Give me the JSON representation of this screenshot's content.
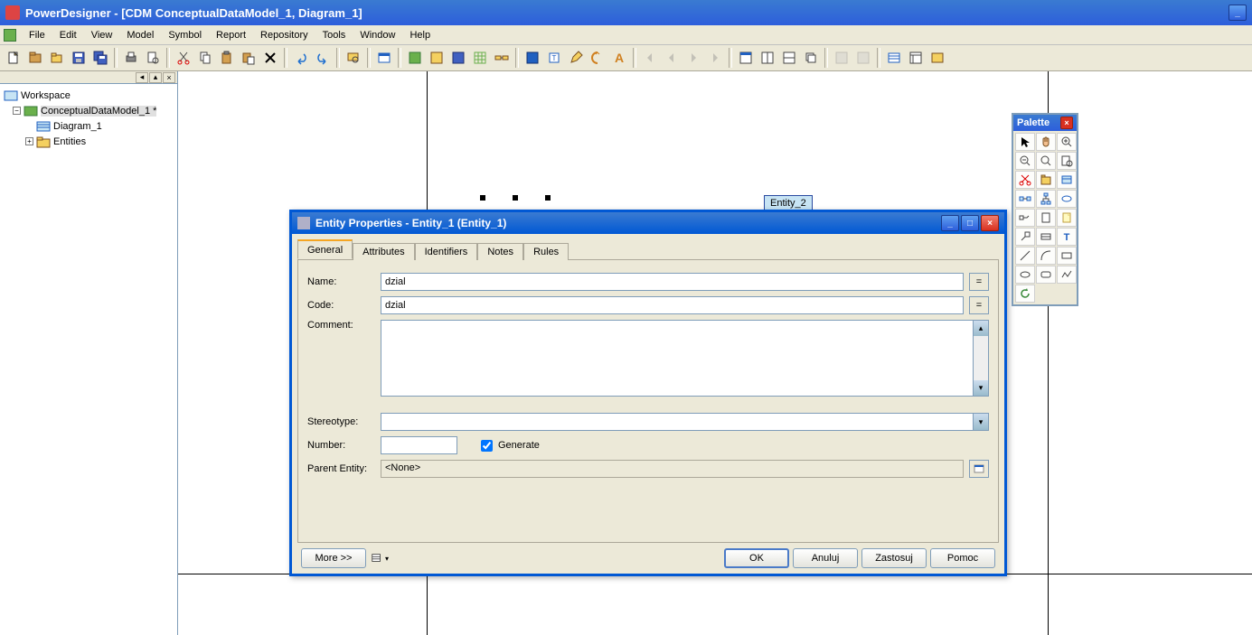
{
  "app": {
    "title": "PowerDesigner - [CDM ConceptualDataModel_1, Diagram_1]"
  },
  "menu": [
    "File",
    "Edit",
    "View",
    "Model",
    "Symbol",
    "Report",
    "Repository",
    "Tools",
    "Window",
    "Help"
  ],
  "tree": {
    "root": "Workspace",
    "model": "ConceptualDataModel_1 *",
    "diagram": "Diagram_1",
    "entities_folder": "Entities"
  },
  "canvas": {
    "entity2_label": "Entity_2"
  },
  "dialog": {
    "title": "Entity Properties - Entity_1 (Entity_1)",
    "tabs": [
      "General",
      "Attributes",
      "Identifiers",
      "Notes",
      "Rules"
    ],
    "labels": {
      "name": "Name:",
      "code": "Code:",
      "comment": "Comment:",
      "stereotype": "Stereotype:",
      "number": "Number:",
      "generate": "Generate",
      "parent_entity": "Parent Entity:"
    },
    "values": {
      "name": "dzial",
      "code": "dzial",
      "comment": "",
      "stereotype": "",
      "number": "",
      "generate_checked": true,
      "parent_entity": "<None>"
    },
    "buttons": {
      "more": "More >>",
      "ok": "OK",
      "cancel": "Anuluj",
      "apply": "Zastosuj",
      "help": "Pomoc",
      "eq": "="
    }
  },
  "palette": {
    "title": "Palette"
  }
}
